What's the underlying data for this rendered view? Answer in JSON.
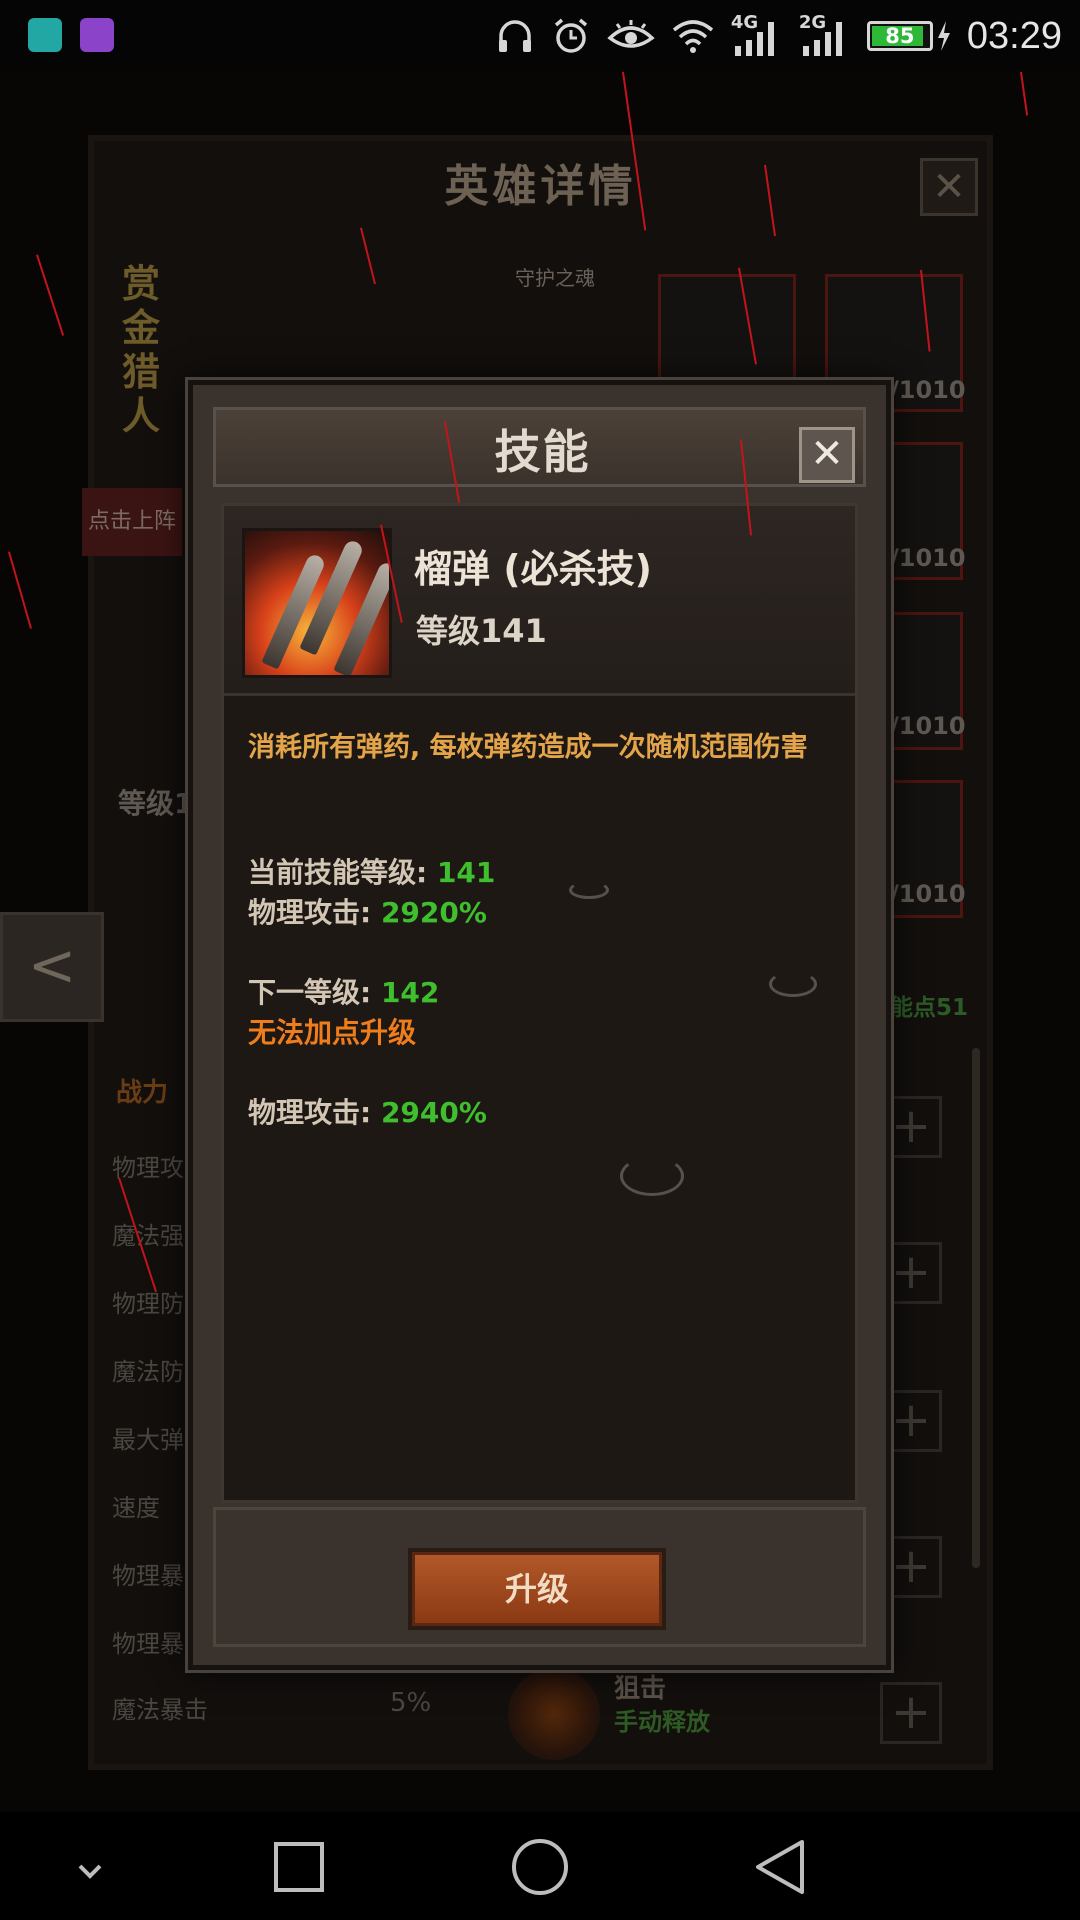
{
  "status_bar": {
    "network_primary": "4G",
    "network_secondary": "2G",
    "battery": "85",
    "battery_level": 0.85,
    "time": "03:29",
    "icons": [
      "app-shortcut-icon",
      "gallery-icon",
      "headphones-icon",
      "alarm-icon",
      "eye-comfort-icon",
      "wifi-icon",
      "signal-icon",
      "signal-icon",
      "battery-icon",
      "charging-icon"
    ]
  },
  "background_window": {
    "title": "英雄详情",
    "close_label": "✕",
    "hero_name": "赏金猎人",
    "guardian_label": "守护之魂",
    "deploy_label": "点击上阵",
    "level_label": "等级1",
    "slot_counts": [
      "/1010",
      "/1010",
      "/1010",
      "/1010"
    ],
    "skill_points": "能点51",
    "power_label": "战力",
    "stats": [
      "物理攻",
      "魔法强",
      "物理防",
      "魔法防",
      "最大弹",
      "速度",
      "物理暴",
      "物理暴",
      "魔法暴击"
    ],
    "last_stat_value": "5%",
    "bottom_skill_name": "狙击",
    "bottom_skill_mode": "手动释放",
    "nav_arrow": "<"
  },
  "dialog": {
    "title": "技能",
    "close_label": "✕",
    "skill": {
      "name": "榴弹 (必杀技)",
      "level_text": "等级141",
      "description": "消耗所有弹药, 每枚弹药造成一次随机范围伤害"
    },
    "current_level_label": "当前技能等级: ",
    "current_level_value": "141",
    "current_attack_label": "物理攻击: ",
    "current_attack_value": "2920%",
    "next_level_label": "下一等级: ",
    "next_level_value": "142",
    "cannot_upgrade": "无法加点升级",
    "next_attack_label": "物理攻击: ",
    "next_attack_value": "2940%",
    "upgrade_button": "升级"
  },
  "colors": {
    "value_green": "#3fbf2d",
    "warning_orange": "#f07d1b",
    "description_gold": "#e3a44a",
    "button_brown": "#9e4418"
  }
}
